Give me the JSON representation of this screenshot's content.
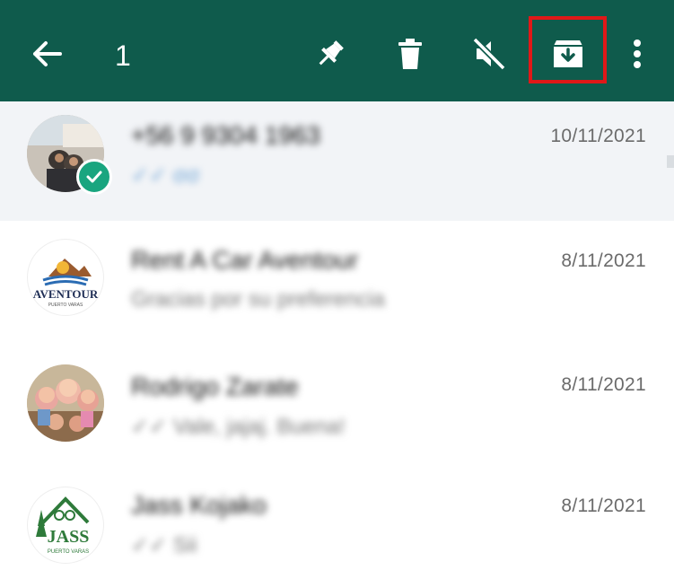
{
  "header": {
    "selected_count": "1",
    "colors": {
      "bar": "#0f5b4c",
      "icon": "#ffffff",
      "highlight": "#e01818"
    },
    "icons": [
      "back-arrow-icon",
      "pin-icon",
      "trash-icon",
      "mute-icon",
      "archive-icon",
      "more-vert-icon"
    ]
  },
  "chats": [
    {
      "name": "+56 9 9304 1963",
      "preview": "✓✓ σσ",
      "date": "10/11/2021",
      "selected": true
    },
    {
      "name": "Rent A Car Aventour",
      "preview": "Gracias por su preferencia",
      "date": "8/11/2021",
      "selected": false
    },
    {
      "name": "Rodrigo Zarate",
      "preview": "✓✓ Vale, jajaj. Buena!",
      "date": "8/11/2021",
      "selected": false
    },
    {
      "name": "Jass Kojako",
      "preview": "✓✓ Sii",
      "date": "8/11/2021",
      "selected": false
    }
  ],
  "logos": {
    "aventour": {
      "text": "AVENTOUR",
      "sub": "PUERTO VARAS"
    },
    "jass": {
      "text": "JASS",
      "sub": "PUERTO VARAS"
    }
  }
}
